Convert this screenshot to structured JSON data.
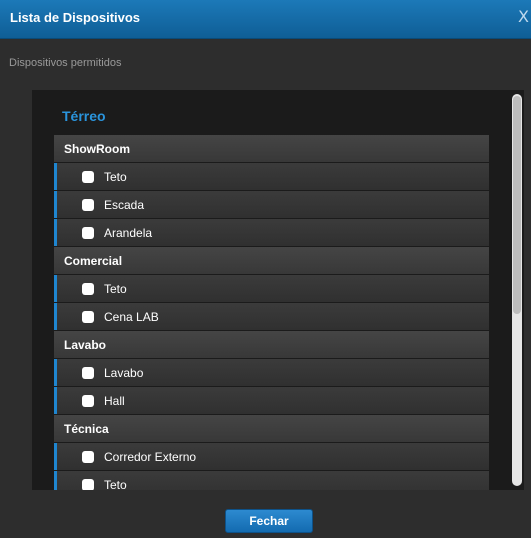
{
  "dialog": {
    "title": "Lista de Dispositivos",
    "close_label": "X",
    "subtitle": "Dispositivos permitidos"
  },
  "floor": {
    "title": "Térreo"
  },
  "rooms": [
    {
      "name": "ShowRoom",
      "devices": [
        "Teto",
        "Escada",
        "Arandela"
      ]
    },
    {
      "name": "Comercial",
      "devices": [
        "Teto",
        "Cena LAB"
      ]
    },
    {
      "name": "Lavabo",
      "devices": [
        "Lavabo",
        "Hall"
      ]
    },
    {
      "name": "Técnica",
      "devices": [
        "Corredor Externo",
        "Teto"
      ]
    }
  ],
  "footer": {
    "close_button_label": "Fechar"
  },
  "colors": {
    "accent": "#1f86d0",
    "title_bar": "#1570ad",
    "floor_title": "#2a94dc"
  },
  "checkboxes_checked": false
}
